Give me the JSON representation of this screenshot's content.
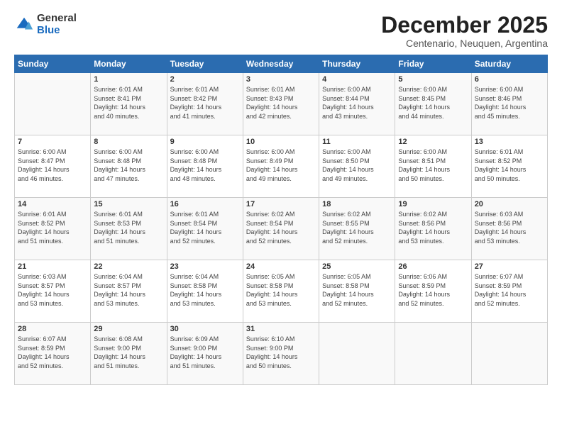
{
  "header": {
    "logo_general": "General",
    "logo_blue": "Blue",
    "month_title": "December 2025",
    "subtitle": "Centenario, Neuquen, Argentina"
  },
  "days_of_week": [
    "Sunday",
    "Monday",
    "Tuesday",
    "Wednesday",
    "Thursday",
    "Friday",
    "Saturday"
  ],
  "weeks": [
    [
      {
        "day": "",
        "info": ""
      },
      {
        "day": "1",
        "info": "Sunrise: 6:01 AM\nSunset: 8:41 PM\nDaylight: 14 hours\nand 40 minutes."
      },
      {
        "day": "2",
        "info": "Sunrise: 6:01 AM\nSunset: 8:42 PM\nDaylight: 14 hours\nand 41 minutes."
      },
      {
        "day": "3",
        "info": "Sunrise: 6:01 AM\nSunset: 8:43 PM\nDaylight: 14 hours\nand 42 minutes."
      },
      {
        "day": "4",
        "info": "Sunrise: 6:00 AM\nSunset: 8:44 PM\nDaylight: 14 hours\nand 43 minutes."
      },
      {
        "day": "5",
        "info": "Sunrise: 6:00 AM\nSunset: 8:45 PM\nDaylight: 14 hours\nand 44 minutes."
      },
      {
        "day": "6",
        "info": "Sunrise: 6:00 AM\nSunset: 8:46 PM\nDaylight: 14 hours\nand 45 minutes."
      }
    ],
    [
      {
        "day": "7",
        "info": "Sunrise: 6:00 AM\nSunset: 8:47 PM\nDaylight: 14 hours\nand 46 minutes."
      },
      {
        "day": "8",
        "info": "Sunrise: 6:00 AM\nSunset: 8:48 PM\nDaylight: 14 hours\nand 47 minutes."
      },
      {
        "day": "9",
        "info": "Sunrise: 6:00 AM\nSunset: 8:48 PM\nDaylight: 14 hours\nand 48 minutes."
      },
      {
        "day": "10",
        "info": "Sunrise: 6:00 AM\nSunset: 8:49 PM\nDaylight: 14 hours\nand 49 minutes."
      },
      {
        "day": "11",
        "info": "Sunrise: 6:00 AM\nSunset: 8:50 PM\nDaylight: 14 hours\nand 49 minutes."
      },
      {
        "day": "12",
        "info": "Sunrise: 6:00 AM\nSunset: 8:51 PM\nDaylight: 14 hours\nand 50 minutes."
      },
      {
        "day": "13",
        "info": "Sunrise: 6:01 AM\nSunset: 8:52 PM\nDaylight: 14 hours\nand 50 minutes."
      }
    ],
    [
      {
        "day": "14",
        "info": "Sunrise: 6:01 AM\nSunset: 8:52 PM\nDaylight: 14 hours\nand 51 minutes."
      },
      {
        "day": "15",
        "info": "Sunrise: 6:01 AM\nSunset: 8:53 PM\nDaylight: 14 hours\nand 51 minutes."
      },
      {
        "day": "16",
        "info": "Sunrise: 6:01 AM\nSunset: 8:54 PM\nDaylight: 14 hours\nand 52 minutes."
      },
      {
        "day": "17",
        "info": "Sunrise: 6:02 AM\nSunset: 8:54 PM\nDaylight: 14 hours\nand 52 minutes."
      },
      {
        "day": "18",
        "info": "Sunrise: 6:02 AM\nSunset: 8:55 PM\nDaylight: 14 hours\nand 52 minutes."
      },
      {
        "day": "19",
        "info": "Sunrise: 6:02 AM\nSunset: 8:56 PM\nDaylight: 14 hours\nand 53 minutes."
      },
      {
        "day": "20",
        "info": "Sunrise: 6:03 AM\nSunset: 8:56 PM\nDaylight: 14 hours\nand 53 minutes."
      }
    ],
    [
      {
        "day": "21",
        "info": "Sunrise: 6:03 AM\nSunset: 8:57 PM\nDaylight: 14 hours\nand 53 minutes."
      },
      {
        "day": "22",
        "info": "Sunrise: 6:04 AM\nSunset: 8:57 PM\nDaylight: 14 hours\nand 53 minutes."
      },
      {
        "day": "23",
        "info": "Sunrise: 6:04 AM\nSunset: 8:58 PM\nDaylight: 14 hours\nand 53 minutes."
      },
      {
        "day": "24",
        "info": "Sunrise: 6:05 AM\nSunset: 8:58 PM\nDaylight: 14 hours\nand 53 minutes."
      },
      {
        "day": "25",
        "info": "Sunrise: 6:05 AM\nSunset: 8:58 PM\nDaylight: 14 hours\nand 52 minutes."
      },
      {
        "day": "26",
        "info": "Sunrise: 6:06 AM\nSunset: 8:59 PM\nDaylight: 14 hours\nand 52 minutes."
      },
      {
        "day": "27",
        "info": "Sunrise: 6:07 AM\nSunset: 8:59 PM\nDaylight: 14 hours\nand 52 minutes."
      }
    ],
    [
      {
        "day": "28",
        "info": "Sunrise: 6:07 AM\nSunset: 8:59 PM\nDaylight: 14 hours\nand 52 minutes."
      },
      {
        "day": "29",
        "info": "Sunrise: 6:08 AM\nSunset: 9:00 PM\nDaylight: 14 hours\nand 51 minutes."
      },
      {
        "day": "30",
        "info": "Sunrise: 6:09 AM\nSunset: 9:00 PM\nDaylight: 14 hours\nand 51 minutes."
      },
      {
        "day": "31",
        "info": "Sunrise: 6:10 AM\nSunset: 9:00 PM\nDaylight: 14 hours\nand 50 minutes."
      },
      {
        "day": "",
        "info": ""
      },
      {
        "day": "",
        "info": ""
      },
      {
        "day": "",
        "info": ""
      }
    ]
  ]
}
